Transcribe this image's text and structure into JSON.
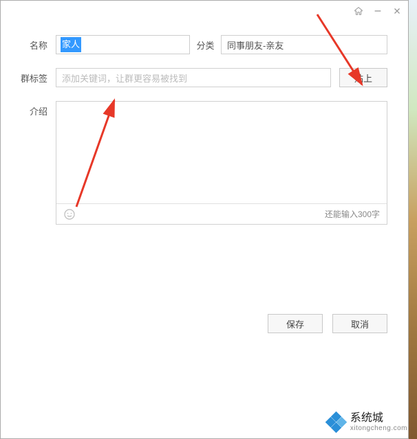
{
  "titlebar": {
    "home_icon": "home",
    "min_icon": "minimize",
    "close_icon": "close"
  },
  "form": {
    "name_label": "名称",
    "name_value": "家人",
    "category_label": "分类",
    "category_value": "同事朋友-亲友",
    "tag_label": "群标签",
    "tag_placeholder": "添加关键词，让群更容易被找到",
    "paste_label": "贴上",
    "desc_label": "介绍",
    "desc_value": "",
    "char_limit_text": "还能输入300字"
  },
  "buttons": {
    "save": "保存",
    "cancel": "取消"
  },
  "watermark": {
    "title": "系统城",
    "url": "xitongcheng.com"
  }
}
